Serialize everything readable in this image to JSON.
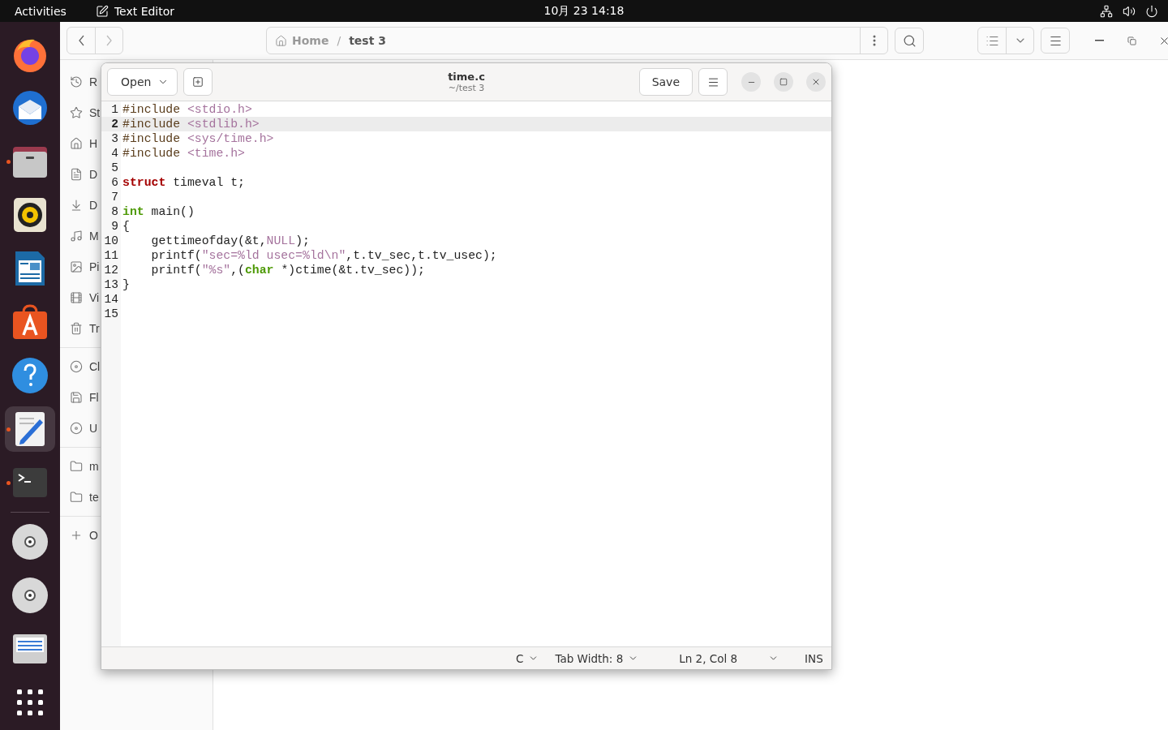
{
  "top_bar": {
    "activities": "Activities",
    "app_name": "Text Editor",
    "clock": "10月 23  14:18"
  },
  "dock": [
    {
      "kind": "firefox",
      "running": false,
      "selected": false
    },
    {
      "kind": "thunderbird",
      "running": false,
      "selected": false
    },
    {
      "kind": "files",
      "running": true,
      "selected": false
    },
    {
      "kind": "rhythmbox",
      "running": false,
      "selected": false
    },
    {
      "kind": "writer",
      "running": false,
      "selected": false
    },
    {
      "kind": "software",
      "running": false,
      "selected": false
    },
    {
      "kind": "help",
      "running": false,
      "selected": false
    },
    {
      "kind": "editor",
      "running": true,
      "selected": true
    },
    {
      "kind": "terminal",
      "running": true,
      "selected": false
    },
    {
      "kind": "separator"
    },
    {
      "kind": "disc",
      "running": false,
      "selected": false
    },
    {
      "kind": "disc",
      "running": false,
      "selected": false
    },
    {
      "kind": "drive",
      "running": false,
      "selected": false
    },
    {
      "kind": "apps",
      "running": false,
      "selected": false
    }
  ],
  "files_window": {
    "path_separator": "/",
    "path": [
      {
        "label": "Home",
        "kind": "home",
        "selected": false
      },
      {
        "label": "test 3",
        "kind": "folder",
        "selected": true
      }
    ],
    "sidebar": [
      [
        {
          "label": "R",
          "kind": "recent"
        },
        {
          "label": "St",
          "kind": "starred"
        },
        {
          "label": "H",
          "kind": "home"
        },
        {
          "label": "D",
          "kind": "document"
        },
        {
          "label": "D",
          "kind": "download"
        },
        {
          "label": "M",
          "kind": "music"
        },
        {
          "label": "Pi",
          "kind": "picture"
        },
        {
          "label": "Vi",
          "kind": "video"
        },
        {
          "label": "Tr",
          "kind": "trash"
        }
      ],
      [
        {
          "label": "Cl",
          "kind": "disc"
        },
        {
          "label": "Fl",
          "kind": "floppy"
        },
        {
          "label": "U",
          "kind": "disc"
        }
      ],
      [
        {
          "label": "m",
          "kind": "folder"
        },
        {
          "label": "te",
          "kind": "folder"
        }
      ],
      [
        {
          "label": "O",
          "kind": "plus"
        }
      ]
    ]
  },
  "editor": {
    "open_button": "Open",
    "title": "time.c",
    "subtitle": "~/test 3",
    "save_button": "Save",
    "lines": [
      {
        "number": "1",
        "selected": false,
        "tokens": [
          {
            "text": "#include",
            "kind": "preproc"
          },
          {
            "text": " <stdio.h>",
            "kind": "header"
          }
        ]
      },
      {
        "number": "2",
        "selected": true,
        "tokens": [
          {
            "text": "#include",
            "kind": "preproc"
          },
          {
            "text": " <stdlib.h>",
            "kind": "header"
          }
        ]
      },
      {
        "number": "3",
        "selected": false,
        "tokens": [
          {
            "text": "#include",
            "kind": "preproc"
          },
          {
            "text": " <sys/time.h>",
            "kind": "header"
          }
        ]
      },
      {
        "number": "4",
        "selected": false,
        "tokens": [
          {
            "text": "#include",
            "kind": "preproc"
          },
          {
            "text": " <time.h>",
            "kind": "header"
          }
        ]
      },
      {
        "number": "5",
        "selected": false
      },
      {
        "number": "6",
        "selected": false,
        "tokens": [
          {
            "text": "struct",
            "kind": "keyword"
          },
          {
            "text": " timeval t;",
            "kind": "plain"
          }
        ]
      },
      {
        "number": "7",
        "selected": false
      },
      {
        "number": "8",
        "selected": false,
        "tokens": [
          {
            "text": "int",
            "kind": "type"
          },
          {
            "text": " main()",
            "kind": "plain"
          }
        ]
      },
      {
        "number": "9",
        "selected": false,
        "tokens": [
          {
            "text": "{",
            "kind": "plain"
          }
        ]
      },
      {
        "number": "10",
        "selected": false,
        "tokens": [
          {
            "text": "    gettimeofday(&t,",
            "kind": "plain"
          },
          {
            "text": "NULL",
            "kind": "constant"
          },
          {
            "text": ");",
            "kind": "plain"
          }
        ]
      },
      {
        "number": "11",
        "selected": false,
        "tokens": [
          {
            "text": "    printf(",
            "kind": "plain"
          },
          {
            "text": "\"sec=%ld usec=%ld\\n\"",
            "kind": "string"
          },
          {
            "text": ",t.tv_sec,t.tv_usec);",
            "kind": "plain"
          }
        ]
      },
      {
        "number": "12",
        "selected": false,
        "tokens": [
          {
            "text": "    printf(",
            "kind": "plain"
          },
          {
            "text": "\"%s\"",
            "kind": "string"
          },
          {
            "text": ",(",
            "kind": "plain"
          },
          {
            "text": "char",
            "kind": "type"
          },
          {
            "text": " *)ctime(&t.tv_sec));",
            "kind": "plain"
          }
        ]
      },
      {
        "number": "13",
        "selected": false,
        "tokens": [
          {
            "text": "}",
            "kind": "plain"
          }
        ]
      },
      {
        "number": "14",
        "selected": false
      },
      {
        "number": "15",
        "selected": false
      }
    ],
    "status": {
      "language": "C",
      "tab_width": "Tab Width: 8",
      "position": "Ln 2, Col 8",
      "mode": "INS"
    }
  }
}
